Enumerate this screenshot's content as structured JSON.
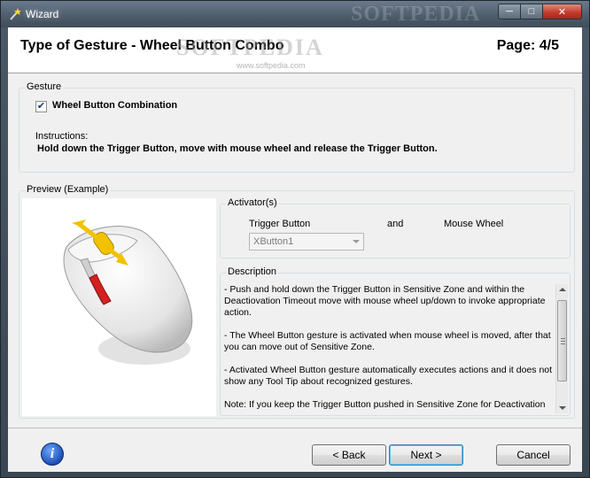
{
  "window": {
    "title": "Wizard",
    "watermark": "SOFTPEDIA",
    "controls": {
      "minimize": "─",
      "maximize": "□",
      "close": "✕"
    }
  },
  "header": {
    "title": "Type of Gesture - Wheel Button Combo",
    "page": "Page: 4/5",
    "watermark_big": "SOFTPEDIA",
    "watermark_url": "www.softpedia.com"
  },
  "gesture": {
    "legend": "Gesture",
    "checkbox_label": "Wheel Button Combination",
    "checked": true,
    "instructions_label": "Instructions:",
    "instructions_text": "Hold down the Trigger Button, move with mouse wheel and release the Trigger Button."
  },
  "preview": {
    "legend": "Preview (Example)",
    "activator": {
      "legend": "Activator(s)",
      "trigger_label": "Trigger Button",
      "and_label": "and",
      "wheel_label": "Mouse Wheel",
      "trigger_value": "XButton1"
    },
    "description": {
      "legend": "Description",
      "paragraphs": [
        "- Push and hold down the Trigger Button in Sensitive Zone and within the Deactiovation Timeout move with mouse wheel up/down to invoke appropriate action.",
        "- The Wheel Button gesture is activated when mouse wheel is moved, after that you can move out of Sensitive Zone.",
        "- Activated Wheel Button gesture automatically executes actions and it does not show any Tool Tip about recognized gestures.",
        "Note: If you keep the Trigger Button pushed in Sensitive Zone for Deactivation"
      ]
    }
  },
  "footer": {
    "back": "< Back",
    "next": "Next >",
    "cancel": "Cancel"
  },
  "colors": {
    "accent_yellow": "#f2c200",
    "trigger_red": "#d42020",
    "info_blue": "#1c4fb5"
  }
}
